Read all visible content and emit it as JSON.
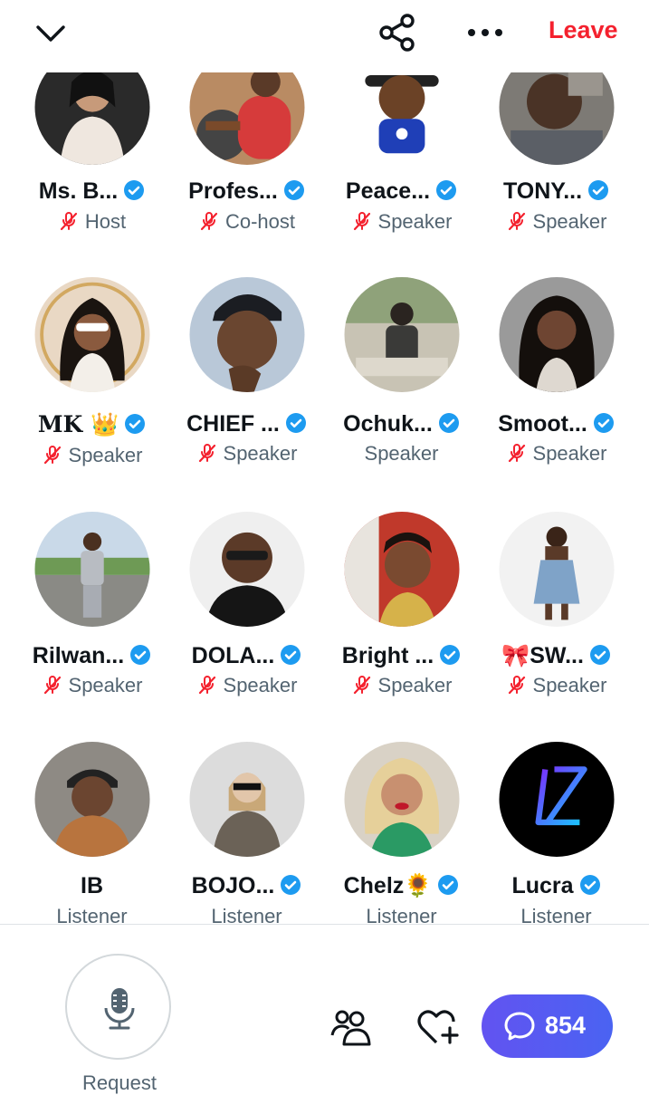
{
  "topbar": {
    "leave_label": "Leave"
  },
  "colors": {
    "accent_red": "#f4212e",
    "verified_blue": "#1d9bf0",
    "pill": "#5a59f2"
  },
  "participants": [
    {
      "name": "Ms. B...",
      "role": "Host",
      "muted": true,
      "verified": true
    },
    {
      "name": "Profes...",
      "role": "Co-host",
      "muted": true,
      "verified": true
    },
    {
      "name": "Peace...",
      "role": "Speaker",
      "muted": true,
      "verified": true
    },
    {
      "name": "TONY...",
      "role": "Speaker",
      "muted": true,
      "verified": true
    },
    {
      "name": "MK 👑",
      "role": "Speaker",
      "muted": true,
      "verified": true
    },
    {
      "name": "CHIEF ...",
      "role": "Speaker",
      "muted": true,
      "verified": true
    },
    {
      "name": "Ochuk...",
      "role": "Speaker",
      "muted": false,
      "verified": true
    },
    {
      "name": "Smoot...",
      "role": "Speaker",
      "muted": true,
      "verified": true
    },
    {
      "name": "Rilwan...",
      "role": "Speaker",
      "muted": true,
      "verified": true
    },
    {
      "name": "DOLA...",
      "role": "Speaker",
      "muted": true,
      "verified": true
    },
    {
      "name": "Bright ...",
      "role": "Speaker",
      "muted": true,
      "verified": true
    },
    {
      "name": "🎀SW...",
      "role": "Speaker",
      "muted": true,
      "verified": true
    },
    {
      "name": "IB",
      "role": "Listener",
      "muted": false,
      "verified": false
    },
    {
      "name": "BOJO...",
      "role": "Listener",
      "muted": false,
      "verified": true
    },
    {
      "name": "Chelz🌻",
      "role": "Listener",
      "muted": false,
      "verified": true
    },
    {
      "name": "Lucra",
      "role": "Listener",
      "muted": false,
      "verified": true
    }
  ],
  "bottom": {
    "request_label": "Request",
    "chat_count": "854"
  },
  "icons": [
    "chevron-down-icon",
    "share-icon",
    "more-icon",
    "verified-icon",
    "mic-off-icon",
    "mic-icon",
    "people-icon",
    "heart-plus-icon",
    "chat-icon"
  ]
}
